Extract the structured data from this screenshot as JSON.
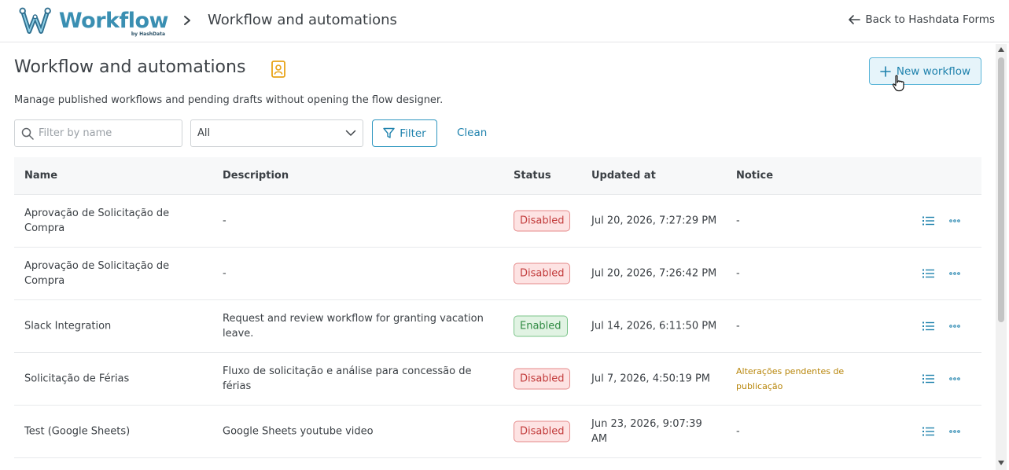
{
  "header": {
    "logo_word": "Workflow",
    "logo_sub": "by HashData",
    "breadcrumb_title": "Workflow and automations",
    "back_label": "Back to Hashdata Forms"
  },
  "page": {
    "title": "Workflow and automations",
    "subtitle": "Manage published workflows and pending drafts without opening the flow designer.",
    "new_button_label": "New workflow"
  },
  "filters": {
    "search_placeholder": "Filter by name",
    "search_value": "",
    "status_selected": "All",
    "filter_label": "Filter",
    "clean_label": "Clean"
  },
  "table": {
    "columns": [
      "Name",
      "Description",
      "Status",
      "Updated at",
      "Notice"
    ],
    "rows": [
      {
        "name": "Aprovação de Solicitação de Compra",
        "description": "-",
        "status": "Disabled",
        "updated": "Jul 20, 2026, 7:27:29 PM",
        "notice": "-"
      },
      {
        "name": "Aprovação de Solicitação de Compra",
        "description": "-",
        "status": "Disabled",
        "updated": "Jul 20, 2026, 7:26:42 PM",
        "notice": "-"
      },
      {
        "name": "Slack Integration",
        "description": "Request and review workflow for granting vacation leave.",
        "status": "Enabled",
        "updated": "Jul 14, 2026, 6:11:50 PM",
        "notice": "-"
      },
      {
        "name": "Solicitação de Férias",
        "description": "Fluxo de solicitação e análise para concessão de férias",
        "status": "Disabled",
        "updated": "Jul 7, 2026, 4:50:19 PM",
        "notice": "Alterações pendentes de publicação"
      },
      {
        "name": "Test (Google Sheets)",
        "description": "Google Sheets youtube video",
        "status": "Disabled",
        "updated": "Jun 23, 2026, 9:07:39 AM",
        "notice": "-"
      }
    ]
  },
  "colors": {
    "accent": "#1f82ad",
    "disabled_bg": "#fde3e3",
    "enabled_bg": "#e1f3e3",
    "notice_warning": "#b8860b"
  }
}
